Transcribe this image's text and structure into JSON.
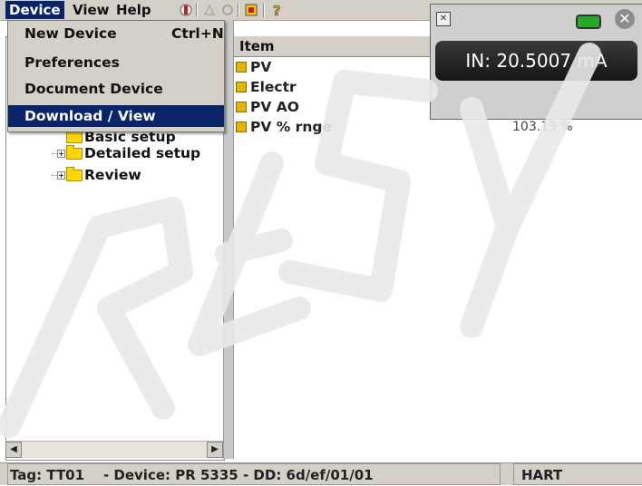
{
  "menubar": {
    "items": [
      "Device",
      "View",
      "Help"
    ]
  },
  "device_menu": {
    "items": [
      {
        "label": "New Device",
        "shortcut": "Ctrl+N"
      },
      {
        "label": "Preferences",
        "shortcut": ""
      },
      {
        "label": "Document Device",
        "shortcut": ""
      },
      {
        "label": "Download / View",
        "shortcut": ""
      }
    ]
  },
  "tree": {
    "items": [
      "Basic setup",
      "Detailed setup",
      "Review"
    ]
  },
  "list": {
    "header": "Item",
    "rows": [
      {
        "label": "PV",
        "value": ""
      },
      {
        "label": "Electr",
        "value": ""
      },
      {
        "label": "PV AO",
        "value": ""
      },
      {
        "label": "PV % rnge",
        "value": "103.13 %"
      }
    ]
  },
  "reading": {
    "value": "IN: 20.5007 mA"
  },
  "status": {
    "main": "Tag: TT01    - Device: PR 5335 - DD: 6d/ef/01/01",
    "protocol": "HART"
  },
  "icons": [
    "toolbar-connect-icon",
    "toolbar-disconnect-icon",
    "toolbar-refresh-icon",
    "toolbar-device-icon",
    "toolbar-help-icon",
    "shrink-icon",
    "battery-icon",
    "close-icon",
    "folder-icon",
    "param-icon"
  ],
  "colors": {
    "menu_highlight": "#0a246a",
    "folder": "#ffd700",
    "battery": "#28a828",
    "chrome": "#d4d0c8"
  }
}
